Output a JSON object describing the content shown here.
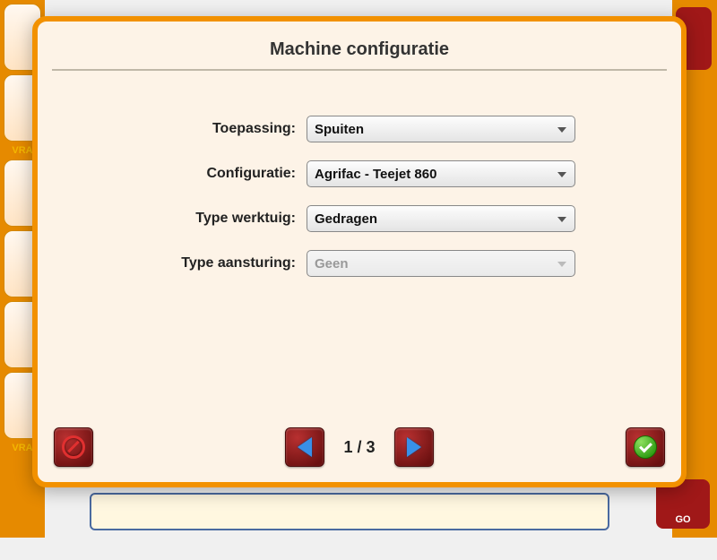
{
  "background": {
    "vra_label": "VRA",
    "go_label": "GO"
  },
  "dialog": {
    "title": "Machine configuratie",
    "fields": {
      "toepassing": {
        "label": "Toepassing:",
        "value": "Spuiten"
      },
      "configuratie": {
        "label": "Configuratie:",
        "value": "Agrifac - Teejet 860"
      },
      "type_werktuig": {
        "label": "Type werktuig:",
        "value": "Gedragen"
      },
      "type_aansturing": {
        "label": "Type aansturing:",
        "value": "Geen"
      }
    },
    "pager": "1 / 3"
  }
}
